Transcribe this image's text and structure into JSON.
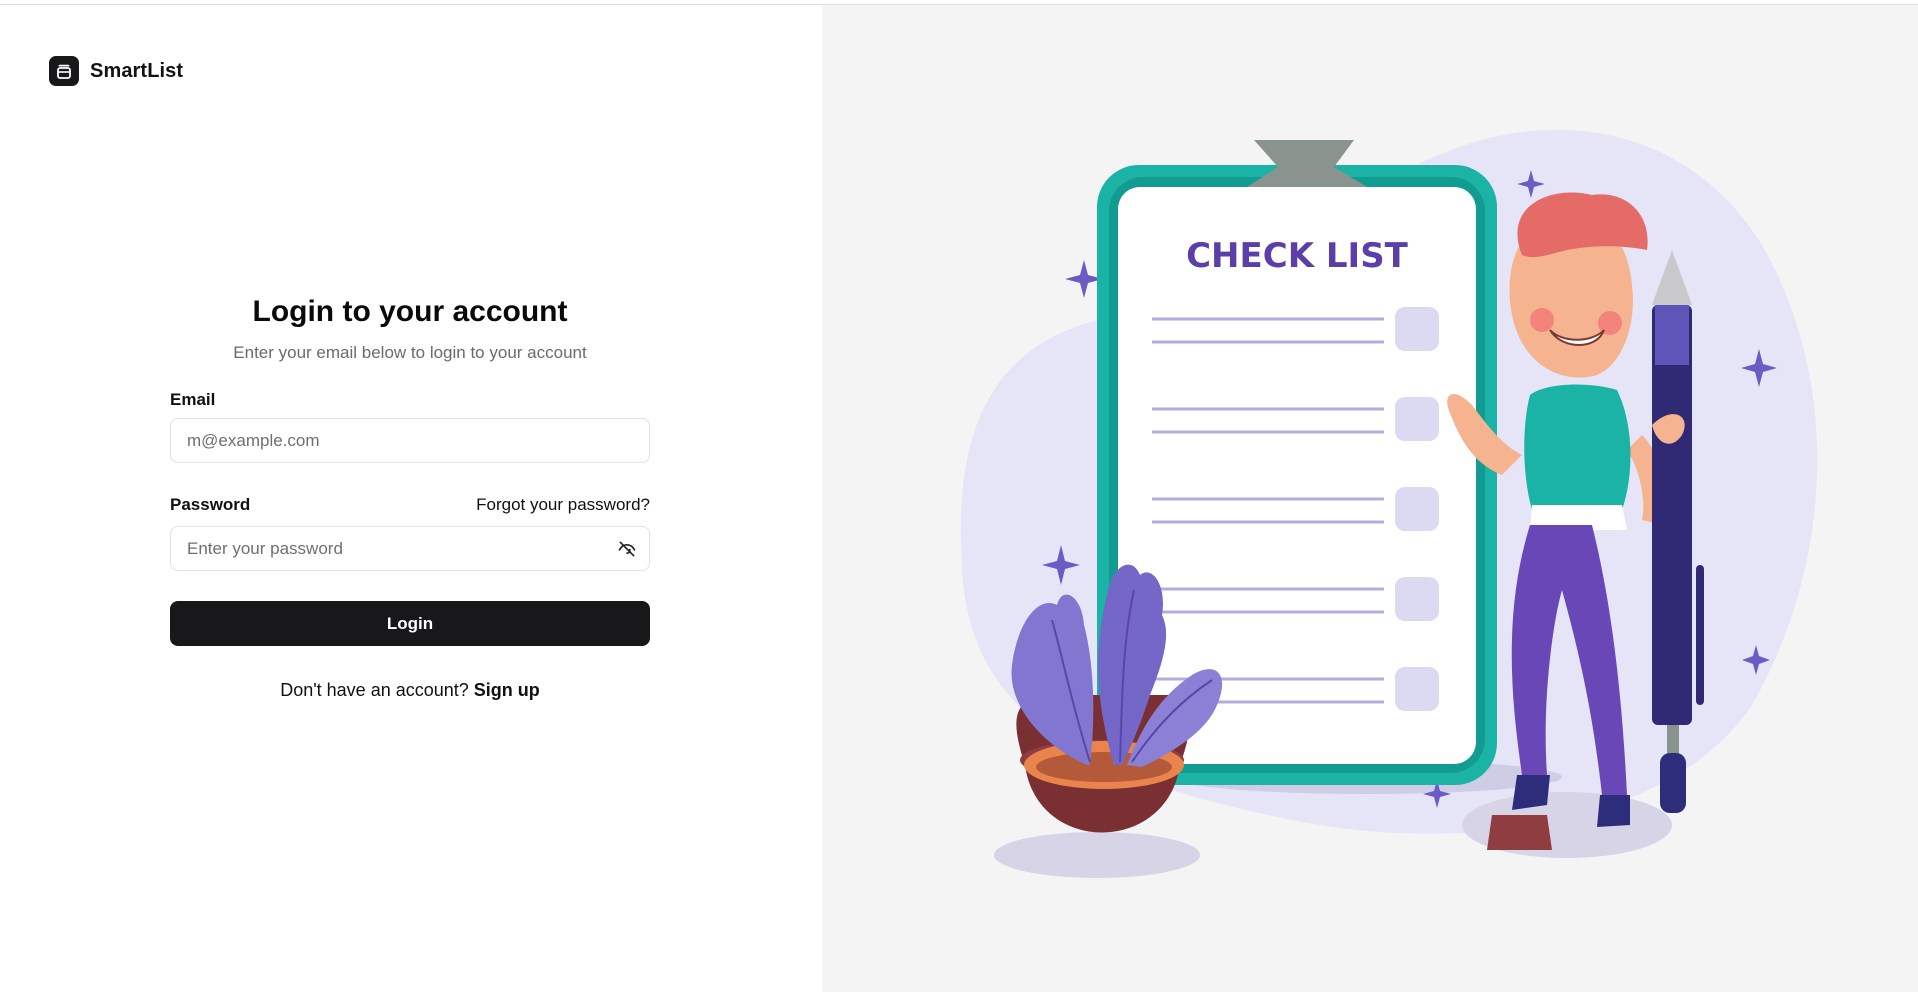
{
  "app": {
    "name": "SmartList"
  },
  "login": {
    "title": "Login to your account",
    "subtitle": "Enter your email below to login to your account",
    "email_label": "Email",
    "email_placeholder": "m@example.com",
    "email_value": "",
    "password_label": "Password",
    "forgot_label": "Forgot your password?",
    "password_placeholder": "Enter your password",
    "password_value": "",
    "submit_label": "Login",
    "signup_prompt": "Don't have an account?",
    "signup_label": "Sign up"
  },
  "illustration": {
    "clipboard_title": "CHECK LIST",
    "checklist_rows": 5
  },
  "colors": {
    "primary": "#18181b",
    "illustration_bg": "#f4f4f4",
    "clipboard_teal": "#1ab3a6",
    "accent_purple": "#5b3ea8",
    "blob_lavender": "#e6e4f7"
  },
  "icons": {
    "brand": "app-logo-icon",
    "password_toggle": "eye-off-icon"
  }
}
